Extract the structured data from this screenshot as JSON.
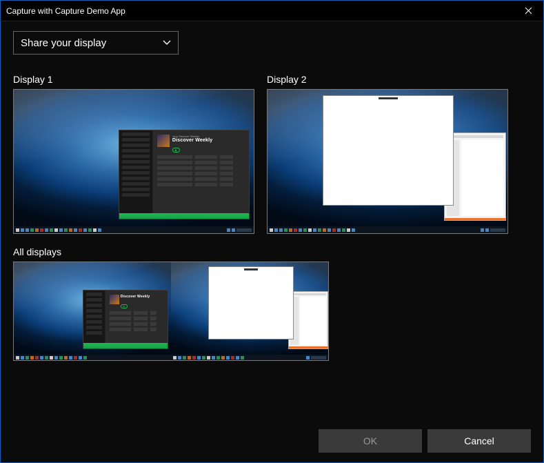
{
  "window": {
    "title": "Capture with Capture Demo App"
  },
  "picker": {
    "dropdown_label": "Share your display",
    "displays": [
      {
        "id": "d1",
        "label": "Display 1",
        "kind": "primary"
      },
      {
        "id": "d2",
        "label": "Display 2",
        "kind": "primary"
      },
      {
        "id": "all",
        "label": "All displays",
        "kind": "wide"
      }
    ],
    "app_mock": {
      "title": "Discover Weekly",
      "subtitle": "Your Discover Weekly"
    }
  },
  "buttons": {
    "ok": "OK",
    "cancel": "Cancel"
  }
}
